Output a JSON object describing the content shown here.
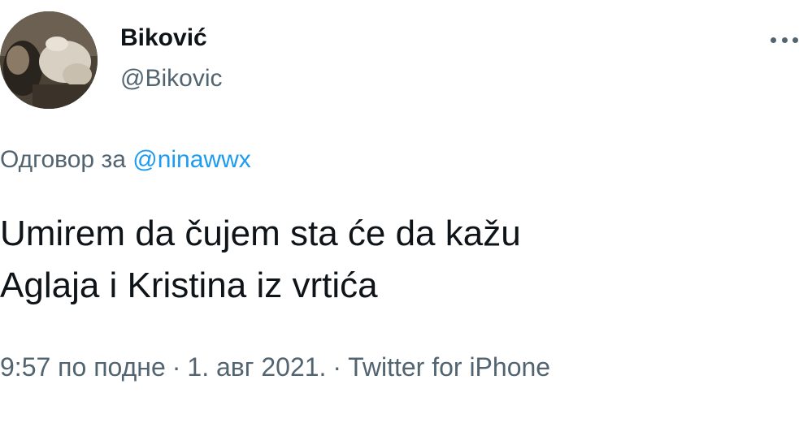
{
  "author": {
    "display_name": "Biković",
    "handle": "@Bikovic"
  },
  "reply": {
    "prefix": "Одговор за",
    "mention": "@ninawwx"
  },
  "tweet": {
    "line1": "Umirem da čujem sta će da kažu",
    "line2": "Aglaja i Kristina iz vrtića"
  },
  "meta": {
    "time": "9:57 по подне",
    "separator": "·",
    "date": "1. авг 2021.",
    "source": "Twitter for iPhone"
  },
  "icons": {
    "more": "more-horizontal-icon"
  },
  "colors": {
    "text": "#0f1419",
    "secondary": "#536471",
    "link": "#1d9bf0"
  }
}
